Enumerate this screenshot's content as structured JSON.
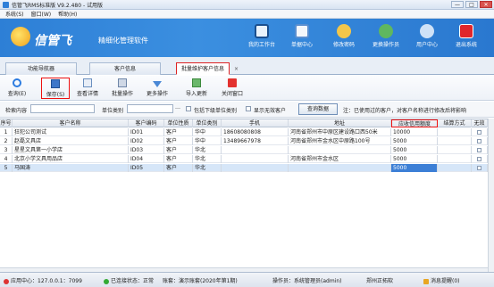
{
  "window": {
    "title": "信管飞RMS标准版 V9.2.480 - 试用版",
    "minimize": "—",
    "maximize": "□",
    "close": "✕"
  },
  "menu": [
    "系统(S)",
    "窗口(W)",
    "帮助(H)"
  ],
  "banner": {
    "brand": "信管飞",
    "slogan": "精细化管理软件",
    "buttons": [
      {
        "label": "我的工作台",
        "icon": "monitor-icon"
      },
      {
        "label": "单据中心",
        "icon": "document-icon"
      },
      {
        "label": "修改密码",
        "icon": "key-icon"
      },
      {
        "label": "更换操作员",
        "icon": "switch-user-icon"
      },
      {
        "label": "用户中心",
        "icon": "user-icon"
      },
      {
        "label": "退出系统",
        "icon": "power-icon"
      }
    ]
  },
  "tabs": [
    "功能导航器",
    "客户信息",
    "批量维护客户信息"
  ],
  "tab_close": "×",
  "toolbar": [
    {
      "label": "查询(E)",
      "icon": "refresh-icon"
    },
    {
      "label": "保存(S)",
      "icon": "save-icon"
    },
    {
      "label": "查看详情",
      "icon": "detail-icon"
    },
    {
      "label": "批量操作",
      "icon": "batch-icon"
    },
    {
      "label": "更多操作",
      "icon": "more-icon"
    },
    {
      "label": "导入更新",
      "icon": "import-icon"
    },
    {
      "label": "关闭窗口",
      "icon": "close-window-icon"
    }
  ],
  "filter": {
    "content_label": "检索内容",
    "category_label": "单位类别",
    "include_sub": "包括下级单位类别",
    "show_invalid": "显示无效客户",
    "query_button": "查询数据",
    "note": "注：已使用过的客户，对客户名称进行修改后将影响"
  },
  "columns": [
    "序号",
    "客户名称",
    "客户编码",
    "单位性质",
    "单位类别",
    "手机",
    "地址",
    "应收信用额度",
    "结算方式",
    "无效"
  ],
  "rows": [
    {
      "no": "1",
      "name": "狂犯公司测试",
      "code": "ID01",
      "nature": "客户",
      "category": "华中",
      "phone": "18608080808",
      "address": "河南省郑州市中原区建设路口西50米",
      "credit": "10000",
      "settle": "",
      "invalid": false
    },
    {
      "no": "2",
      "name": "赵磊文具店",
      "code": "ID02",
      "nature": "客户",
      "category": "华中",
      "phone": "13489667978",
      "address": "河南省郑州市金水区中原路100号",
      "credit": "5000",
      "settle": "",
      "invalid": false
    },
    {
      "no": "3",
      "name": "星星文具第一小学店",
      "code": "ID03",
      "nature": "客户",
      "category": "华北",
      "phone": "",
      "address": "",
      "credit": "5000",
      "settle": "",
      "invalid": false
    },
    {
      "no": "4",
      "name": "北京小学文具用品店",
      "code": "ID04",
      "nature": "客户",
      "category": "华北",
      "phone": "",
      "address": "河南省郑州市金水区",
      "credit": "5000",
      "settle": "",
      "invalid": false
    },
    {
      "no": "5",
      "name": "马国涛",
      "code": "ID05",
      "nature": "客户",
      "category": "华北",
      "phone": "",
      "address": "",
      "credit": "5000",
      "settle": "",
      "invalid": false
    }
  ],
  "status": {
    "app_center": "应用中心：127.0.0.1：7099",
    "connection": "已连接状态：正常",
    "account": "账套：演示账套(2020年第1期)",
    "operator": "操作员：系统管理员(admin)",
    "company": "郑州正拓软",
    "message": "消息提醒(0)"
  },
  "colors": {
    "banner": "#2d7fd6",
    "highlight": "#e11111",
    "selected_row": "#d6e6f8"
  }
}
